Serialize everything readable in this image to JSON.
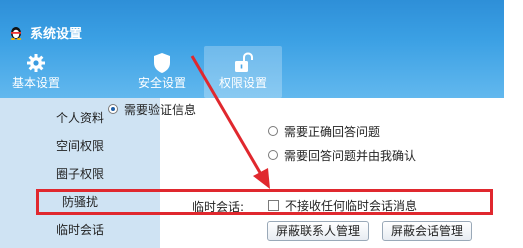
{
  "window": {
    "title": "系统设置"
  },
  "toolbar": {
    "items": [
      {
        "label": "基本设置",
        "icon": "gear-icon"
      },
      {
        "label": "安全设置",
        "icon": "shield-icon"
      },
      {
        "label": "权限设置",
        "icon": "unlock-icon",
        "active": true
      }
    ]
  },
  "sidebar": {
    "items": [
      {
        "label": "个人资料"
      },
      {
        "label": "空间权限"
      },
      {
        "label": "圈子权限"
      },
      {
        "label": "防骚扰",
        "selected": true
      },
      {
        "label": "临时会话"
      }
    ]
  },
  "content": {
    "radio_options": [
      {
        "label": "需要验证信息",
        "checked": true
      },
      {
        "label": "需要正确回答问题",
        "checked": false
      },
      {
        "label": "需要回答问题并由我确认",
        "checked": false
      }
    ],
    "temp_session_label": "临时会话:",
    "temp_session_checkbox": {
      "label": "不接收任何临时会话消息",
      "checked": false
    },
    "buttons": {
      "block_contacts": "屏蔽联系人管理",
      "block_sessions": "屏蔽会话管理"
    }
  },
  "colors": {
    "header": "#3ba0e4",
    "sidebar": "#cfe3f3",
    "highlight": "#e0282e"
  }
}
